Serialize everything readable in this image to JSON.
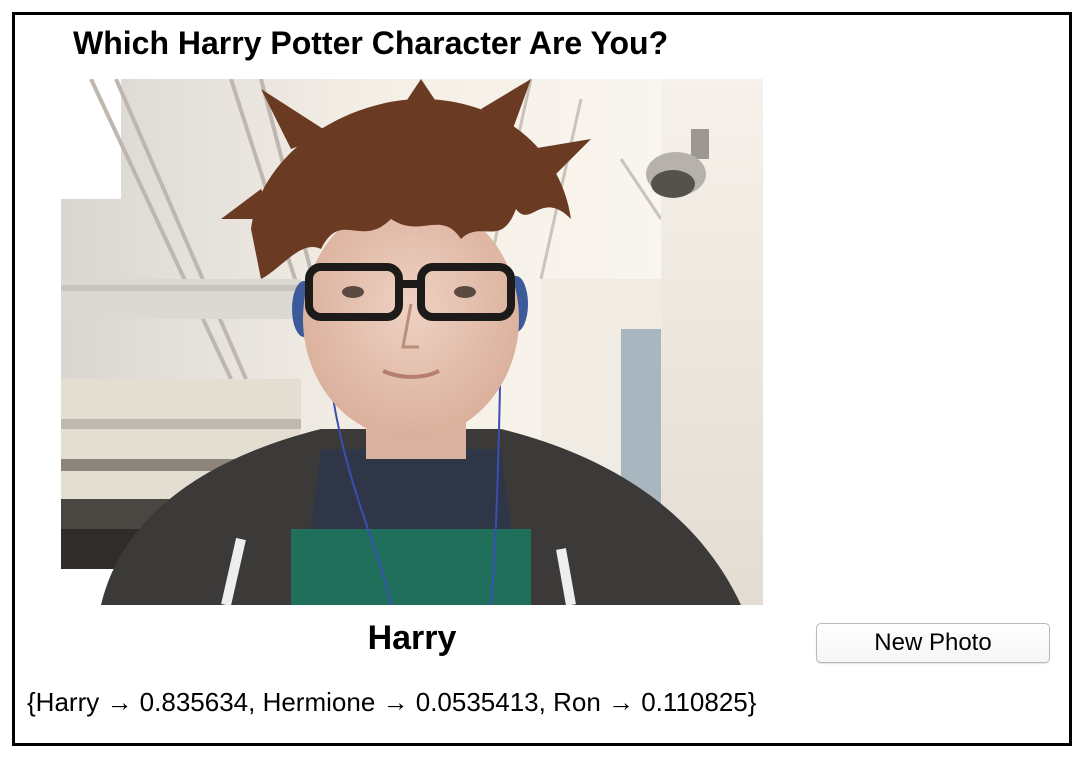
{
  "app": {
    "title": "Which Harry Potter Character Are You?"
  },
  "photo": {
    "description_icon": "webcam-photo"
  },
  "result": {
    "name": "Harry",
    "probabilities_text": "{Harry → 0.835634, Hermione → 0.0535413, Ron → 0.110825}"
  },
  "actions": {
    "new_photo_label": "New Photo"
  },
  "colors": {
    "border": "#000000",
    "button_border": "#b9b9b9",
    "text": "#000000"
  }
}
